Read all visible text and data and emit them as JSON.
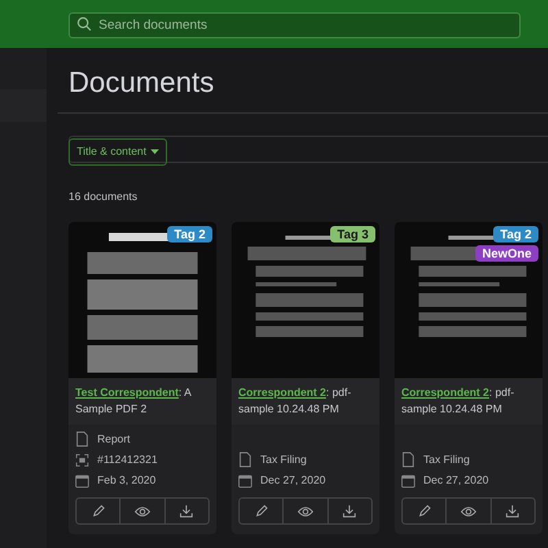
{
  "search": {
    "placeholder": "Search documents"
  },
  "page_title": "Documents",
  "filter": {
    "dropdown": "Title & content"
  },
  "count": "16 documents",
  "documents": [
    {
      "tags": [
        {
          "label": "Tag 2",
          "color": "#2d8ac4"
        }
      ],
      "correspondent": "Test Correspondent",
      "title": ": A Sample PDF 2",
      "meta": [
        {
          "kind": "type",
          "text": "Report"
        },
        {
          "kind": "asn",
          "text": "#112412321"
        },
        {
          "kind": "date",
          "text": "Feb 3, 2020"
        }
      ]
    },
    {
      "tags": [
        {
          "label": "Tag 3",
          "color": "#86c06e"
        }
      ],
      "correspondent": "Correspondent 2",
      "title": ": pdf-sample 10.24.48 PM",
      "meta": [
        {
          "kind": "type",
          "text": "Tax Filing"
        },
        {
          "kind": "date",
          "text": "Dec 27, 2020"
        }
      ]
    },
    {
      "tags": [
        {
          "label": "Tag 2",
          "color": "#2d8ac4"
        },
        {
          "label": "NewOne",
          "color": "#8e3fc1"
        }
      ],
      "correspondent": "Correspondent 2",
      "title": ": pdf-sample 10.24.48 PM",
      "meta": [
        {
          "kind": "type",
          "text": "Tax Filing"
        },
        {
          "kind": "date",
          "text": "Dec 27, 2020"
        }
      ]
    }
  ]
}
